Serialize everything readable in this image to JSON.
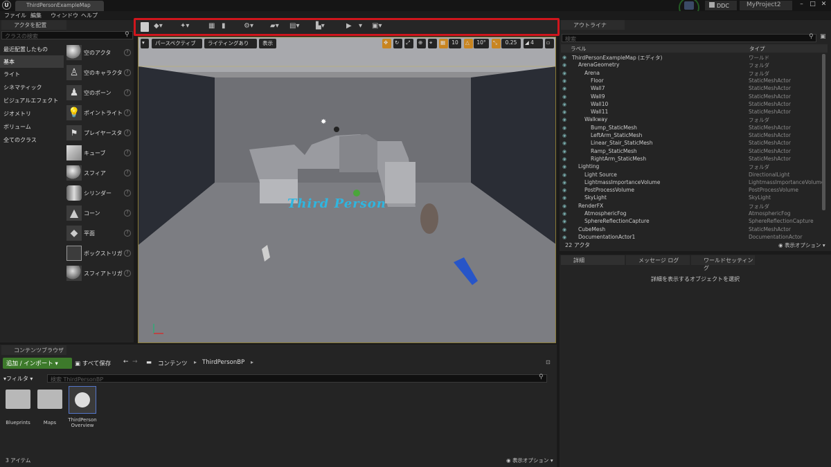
{
  "window": {
    "map_tab": "ThirdPersonExampleMap",
    "ddc": "DDC",
    "project": "MyProject2",
    "controls": [
      "–",
      "□",
      "✕"
    ]
  },
  "menu": [
    "ファイル",
    "編集",
    "ウィンドウ",
    "ヘルプ"
  ],
  "place_actors": {
    "tab": "アクタを配置",
    "search_placeholder": "クラスの検索",
    "categories": [
      "最近配置したもの",
      "基本",
      "ライト",
      "シネマティック",
      "ビジュアルエフェクト",
      "ジオメトリ",
      "ボリューム",
      "全てのクラス"
    ],
    "active_category": "基本",
    "items": [
      "空のアクタ",
      "空のキャラクター",
      "空のポーン",
      "ポイントライト",
      "プレイヤースタート",
      "キューブ",
      "スフィア",
      "シリンダー",
      "コーン",
      "平面",
      "ボックストリガー",
      "スフィアトリガー"
    ]
  },
  "viewport": {
    "perspective": "パースペクティブ",
    "lighting": "ライティングあり",
    "show": "表示",
    "grid_snap": "10",
    "rot_snap": "10°",
    "scale_snap": "0.25",
    "cam_speed": "4",
    "scene_text": "Third Person"
  },
  "outliner": {
    "tab": "アウトライナ",
    "search_placeholder": "検索",
    "col_label": "ラベル",
    "col_type": "タイプ",
    "rows": [
      {
        "name": "ThirdPersonExampleMap (エディタ)",
        "type": "ワールド",
        "indent": 0
      },
      {
        "name": "ArenaGeometry",
        "type": "フォルダ",
        "indent": 1
      },
      {
        "name": "Arena",
        "type": "フォルダ",
        "indent": 2
      },
      {
        "name": "Floor",
        "type": "StaticMeshActor",
        "indent": 3
      },
      {
        "name": "Wall7",
        "type": "StaticMeshActor",
        "indent": 3
      },
      {
        "name": "Wall9",
        "type": "StaticMeshActor",
        "indent": 3
      },
      {
        "name": "Wall10",
        "type": "StaticMeshActor",
        "indent": 3
      },
      {
        "name": "Wall11",
        "type": "StaticMeshActor",
        "indent": 3
      },
      {
        "name": "Walkway",
        "type": "フォルダ",
        "indent": 2
      },
      {
        "name": "Bump_StaticMesh",
        "type": "StaticMeshActor",
        "indent": 3
      },
      {
        "name": "LeftArm_StaticMesh",
        "type": "StaticMeshActor",
        "indent": 3
      },
      {
        "name": "Linear_Stair_StaticMesh",
        "type": "StaticMeshActor",
        "indent": 3
      },
      {
        "name": "Ramp_StaticMesh",
        "type": "StaticMeshActor",
        "indent": 3
      },
      {
        "name": "RightArm_StaticMesh",
        "type": "StaticMeshActor",
        "indent": 3
      },
      {
        "name": "Lighting",
        "type": "フォルダ",
        "indent": 1
      },
      {
        "name": "Light Source",
        "type": "DirectionalLight",
        "indent": 2
      },
      {
        "name": "LightmassImportanceVolume",
        "type": "LightmassImportanceVolume",
        "indent": 2
      },
      {
        "name": "PostProcessVolume",
        "type": "PostProcessVolume",
        "indent": 2
      },
      {
        "name": "SkyLight",
        "type": "SkyLight",
        "indent": 2
      },
      {
        "name": "RenderFX",
        "type": "フォルダ",
        "indent": 1
      },
      {
        "name": "AtmosphericFog",
        "type": "AtmosphericFog",
        "indent": 2
      },
      {
        "name": "SphereReflectionCapture",
        "type": "SphereReflectionCapture",
        "indent": 2
      },
      {
        "name": "CubeMesh",
        "type": "StaticMeshActor",
        "indent": 1
      },
      {
        "name": "DocumentationActor1",
        "type": "DocumentationActor",
        "indent": 1
      }
    ],
    "count": "22 アクタ",
    "view_options": "表示オプション"
  },
  "details": {
    "tabs": [
      "詳細",
      "メッセージ ログ",
      "ワールドセッティング"
    ],
    "empty_message": "詳細を表示するオブジェクトを選択"
  },
  "content_browser": {
    "tab": "コンテンツブラウザ",
    "add_import": "追加 / インポート",
    "save_all": "すべて保存",
    "breadcrumb": [
      "コンテンツ",
      "ThirdPersonBP"
    ],
    "filter": "フィルタ",
    "search_placeholder": "検索 ThirdPersonBP",
    "assets": [
      "Blueprints",
      "Maps",
      "ThirdPerson Overview"
    ],
    "item_count": "3 アイテム",
    "view_options": "表示オプション"
  }
}
